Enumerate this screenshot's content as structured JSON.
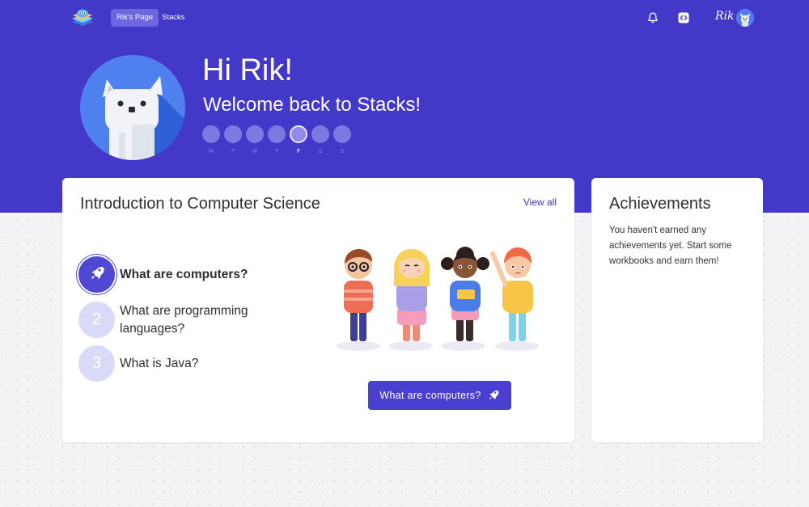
{
  "nav": {
    "links": [
      {
        "label": "Rik's Page",
        "active": true
      },
      {
        "label": "Stacks",
        "active": false
      }
    ],
    "user_name": "Rik"
  },
  "hero": {
    "greeting": "Hi Rik!",
    "subtitle": "Welcome back to Stacks!",
    "days": [
      {
        "letter": "M",
        "current": false
      },
      {
        "letter": "T",
        "current": false
      },
      {
        "letter": "W",
        "current": false
      },
      {
        "letter": "T",
        "current": false
      },
      {
        "letter": "F",
        "current": true
      },
      {
        "letter": "S",
        "current": false
      },
      {
        "letter": "S",
        "current": false
      }
    ]
  },
  "course": {
    "title": "Introduction to Computer Science",
    "view_all": "View all",
    "lessons": [
      {
        "badge": "",
        "icon": "rocket-icon",
        "label": "What are computers?",
        "active": true
      },
      {
        "badge": "2",
        "label": "What are programming languages?",
        "active": false
      },
      {
        "badge": "3",
        "label": "What is Java?",
        "active": false
      }
    ],
    "start_button": "What are computers?"
  },
  "achievements": {
    "title": "Achievements",
    "text": "You haven't earned any achievements yet. Start some workbooks and earn them!"
  },
  "colors": {
    "brand": "#4438c8",
    "accent": "#4a3fd0",
    "link": "#3f35c4",
    "badge_inactive": "#d8dbf8"
  },
  "icons": [
    "stacks-logo-icon",
    "bell-icon",
    "code-icon",
    "cat-avatar-icon",
    "rocket-icon"
  ]
}
